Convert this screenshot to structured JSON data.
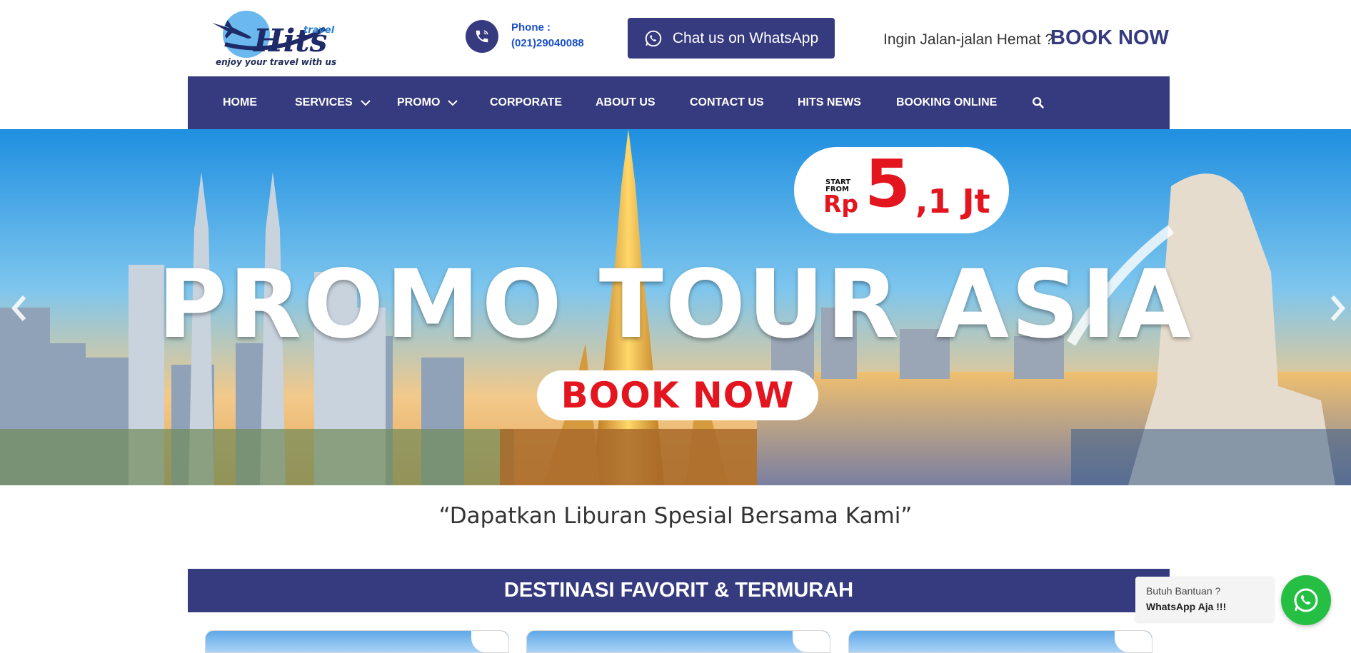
{
  "header": {
    "logo": {
      "brand": "Hits",
      "sub": "travel",
      "tagline": "enjoy your travel with us"
    },
    "phone": {
      "label": "Phone :",
      "number": "(021)29040088"
    },
    "whatsapp_button": "Chat us on WhatsApp",
    "promo_text": "Ingin Jalan-jalan Hemat ?",
    "book_now": "BOOK NOW"
  },
  "nav": {
    "items": [
      {
        "label": "HOME",
        "dropdown": false
      },
      {
        "label": "SERVICES",
        "dropdown": true
      },
      {
        "label": "PROMO",
        "dropdown": true
      },
      {
        "label": "CORPORATE",
        "dropdown": false
      },
      {
        "label": "ABOUT US",
        "dropdown": false
      },
      {
        "label": "CONTACT US",
        "dropdown": false
      },
      {
        "label": "HITS NEWS",
        "dropdown": false
      },
      {
        "label": "BOOKING ONLINE",
        "dropdown": false
      }
    ],
    "search_icon": "search-icon"
  },
  "hero": {
    "title": "PROMO TOUR ASIA",
    "price": {
      "start_line1": "START",
      "start_line2": "FROM",
      "currency": "Rp",
      "big": "5",
      "rest": ",1 Jt"
    },
    "button": "BOOK NOW",
    "prev_icon": "chevron-left-icon",
    "next_icon": "chevron-right-icon"
  },
  "tagline": "“Dapatkan Liburan Spesial Bersama Kami”",
  "destinations": {
    "title": "DESTINASI FAVORIT & TERMURAH"
  },
  "help": {
    "line1": "Butuh Bantuan ?",
    "line2": "WhatsApp Aja !!!"
  },
  "colors": {
    "primary": "#363a7e",
    "accent_red": "#e3151f",
    "whatsapp_green": "#25c043",
    "link_blue": "#1a50c8"
  }
}
